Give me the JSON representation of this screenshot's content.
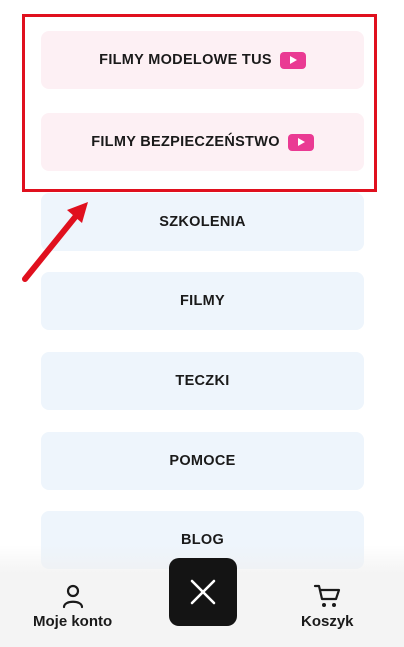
{
  "menu": {
    "items": [
      {
        "label": "FILMY MODELOWE TUS",
        "style": "pink",
        "icon": "youtube-icon"
      },
      {
        "label": "FILMY BEZPIECZEŃSTWO",
        "style": "pink",
        "icon": "youtube-icon"
      },
      {
        "label": "SZKOLENIA",
        "style": "blue"
      },
      {
        "label": "FILMY",
        "style": "blue"
      },
      {
        "label": "TECZKI",
        "style": "blue"
      },
      {
        "label": "POMOCE",
        "style": "blue"
      },
      {
        "label": "BLOG",
        "style": "blue"
      }
    ]
  },
  "bottom_nav": {
    "account_label": "Moje konto",
    "cart_label": "Koszyk",
    "close_icon": "close-icon"
  },
  "colors": {
    "pink_bg": "#fdf0f4",
    "blue_bg": "#eef5fc",
    "youtube_accent": "#ea3a93",
    "highlight": "#e0101e",
    "close_bg": "#141414"
  }
}
